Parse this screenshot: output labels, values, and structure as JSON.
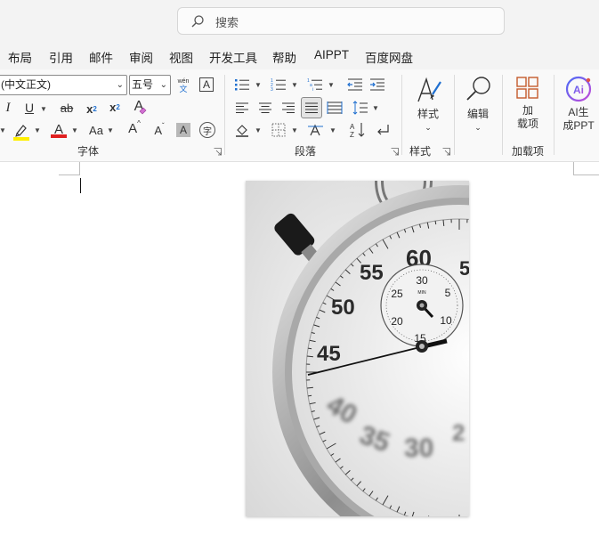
{
  "search": {
    "placeholder": "搜索",
    "icon": "search-icon"
  },
  "tabs": [
    "布局",
    "引用",
    "邮件",
    "审阅",
    "视图",
    "开发工具",
    "帮助",
    "AIPPT",
    "百度网盘"
  ],
  "font": {
    "family_value": "(中文正文)",
    "size_value": "五号",
    "phonetic_top": "wén",
    "phonetic_bottom": "文",
    "border_char": "A",
    "italic": "I",
    "underline": "U",
    "strike": "ab",
    "subscript": "x",
    "subscript_mark": "2",
    "superscript": "x",
    "superscript_mark": "2",
    "clear_format": "A",
    "highlight_color": "#ffef00",
    "font_color": "#e02020",
    "font_color_letter": "A",
    "case": "Aa",
    "grow": "A",
    "shrink": "A",
    "shading": "A",
    "enclose": "字"
  },
  "groups": {
    "font": "字体",
    "paragraph": "段落",
    "styles": "样式",
    "addins": "加载项"
  },
  "big_buttons": {
    "styles": "样式",
    "edit": "编辑",
    "addins_line1": "加",
    "addins_line2": "载项",
    "ai_line1": "AI生",
    "ai_line2": "成PPT",
    "ai_badge": "Ai"
  },
  "image": {
    "description_marks": [
      "60",
      "55",
      "50",
      "45",
      "40",
      "35",
      "30",
      "25",
      "20",
      "15",
      "10",
      "5",
      "MIN"
    ]
  }
}
